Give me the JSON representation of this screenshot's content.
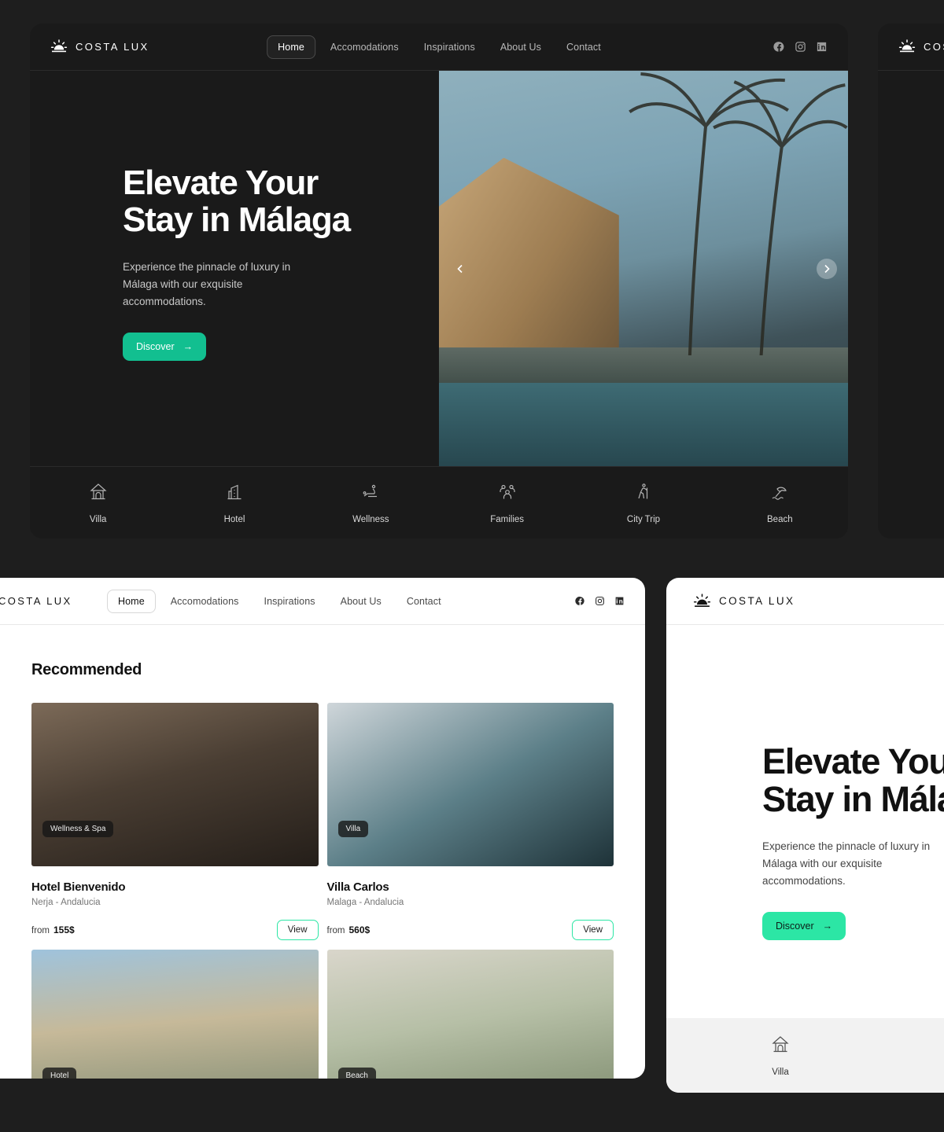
{
  "brand": {
    "name": "COSTA LUX",
    "icon": "sunrise-icon"
  },
  "nav": {
    "items": [
      {
        "label": "Home",
        "active": true
      },
      {
        "label": "Accomodations",
        "active": false
      },
      {
        "label": "Inspirations",
        "active": false
      },
      {
        "label": "About Us",
        "active": false
      },
      {
        "label": "Contact",
        "active": false
      }
    ]
  },
  "socials": [
    {
      "name": "facebook-icon"
    },
    {
      "name": "instagram-icon"
    },
    {
      "name": "linkedin-icon"
    }
  ],
  "hero": {
    "title": "Elevate Your\nStay in Málaga",
    "subtitle": "Experience the pinnacle of luxury in\nMálaga with our exquisite\naccommodations.",
    "cta_label": "Discover",
    "cta_arrow": "→",
    "prev_label": "‹",
    "next_label": "›"
  },
  "categories": [
    {
      "label": "Villa",
      "icon": "pagoda-icon"
    },
    {
      "label": "Hotel",
      "icon": "building-icon"
    },
    {
      "label": "Wellness",
      "icon": "massage-icon"
    },
    {
      "label": "Families",
      "icon": "group-icon"
    },
    {
      "label": "City Trip",
      "icon": "hiker-icon"
    },
    {
      "label": "Beach",
      "icon": "beach-umbrella-icon"
    }
  ],
  "recommended": {
    "title": "Recommended",
    "view_label": "View",
    "from_label": "from",
    "cards": [
      {
        "badge": "Wellness & Spa",
        "name": "Hotel Bienvenido",
        "location": "Nerja - Andalucia",
        "price": "155$",
        "photo": "ph-sauna"
      },
      {
        "badge": "Villa",
        "name": "Villa Carlos",
        "location": "Malaga - Andalucia",
        "price": "560$",
        "photo": "ph-villa"
      },
      {
        "badge": "Hotel",
        "name": "",
        "location": "",
        "price": "",
        "photo": "ph-hotel"
      },
      {
        "badge": "Beach",
        "name": "",
        "location": "",
        "price": "",
        "photo": "ph-beach"
      }
    ]
  },
  "colors": {
    "page_background": "#1e1e1e",
    "panel_dark": "#1a1a1a",
    "panel_light": "#ffffff",
    "accent_green_dark": "#12bf90",
    "accent_green_light": "#2ce6a5",
    "category_strip_light": "#f2f2f2"
  }
}
